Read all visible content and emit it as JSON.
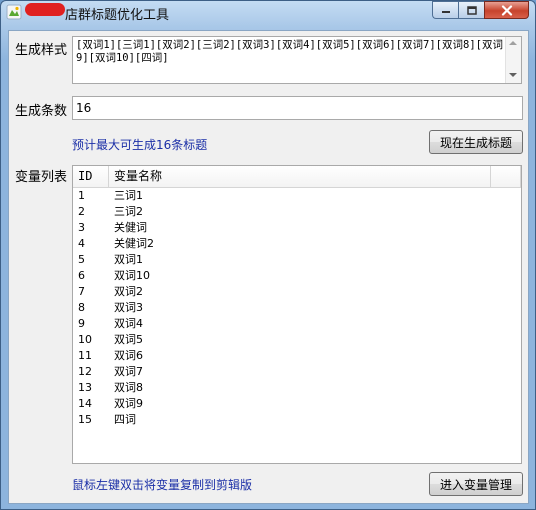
{
  "window": {
    "title": "店群标题优化工具"
  },
  "style_section": {
    "label": "生成样式",
    "value": "[双词1][三词1][双词2][三词2][双词3][双词4][双词5][双词6][双词7][双词8][双词9][双词10][四词]"
  },
  "count_section": {
    "label": "生成条数",
    "value": "16"
  },
  "hint_text": "预计最大可生成16条标题",
  "generate_button": "现在生成标题",
  "variables_section": {
    "label": "变量列表",
    "columns": [
      "ID",
      "变量名称"
    ],
    "rows": [
      {
        "id": "1",
        "name": "三词1"
      },
      {
        "id": "2",
        "name": "三词2"
      },
      {
        "id": "3",
        "name": "关健词"
      },
      {
        "id": "4",
        "name": "关健词2"
      },
      {
        "id": "5",
        "name": "双词1"
      },
      {
        "id": "6",
        "name": "双词10"
      },
      {
        "id": "7",
        "name": "双词2"
      },
      {
        "id": "8",
        "name": "双词3"
      },
      {
        "id": "9",
        "name": "双词4"
      },
      {
        "id": "10",
        "name": "双词5"
      },
      {
        "id": "11",
        "name": "双词6"
      },
      {
        "id": "12",
        "name": "双词7"
      },
      {
        "id": "13",
        "name": "双词8"
      },
      {
        "id": "14",
        "name": "双词9"
      },
      {
        "id": "15",
        "name": "四词"
      }
    ]
  },
  "footer_hint": "鼠标左键双击将变量复制到剪辑版",
  "manage_button": "进入变量管理",
  "colors": {
    "hint_blue": "#1b2fa7",
    "close_red": "#c7432c"
  }
}
